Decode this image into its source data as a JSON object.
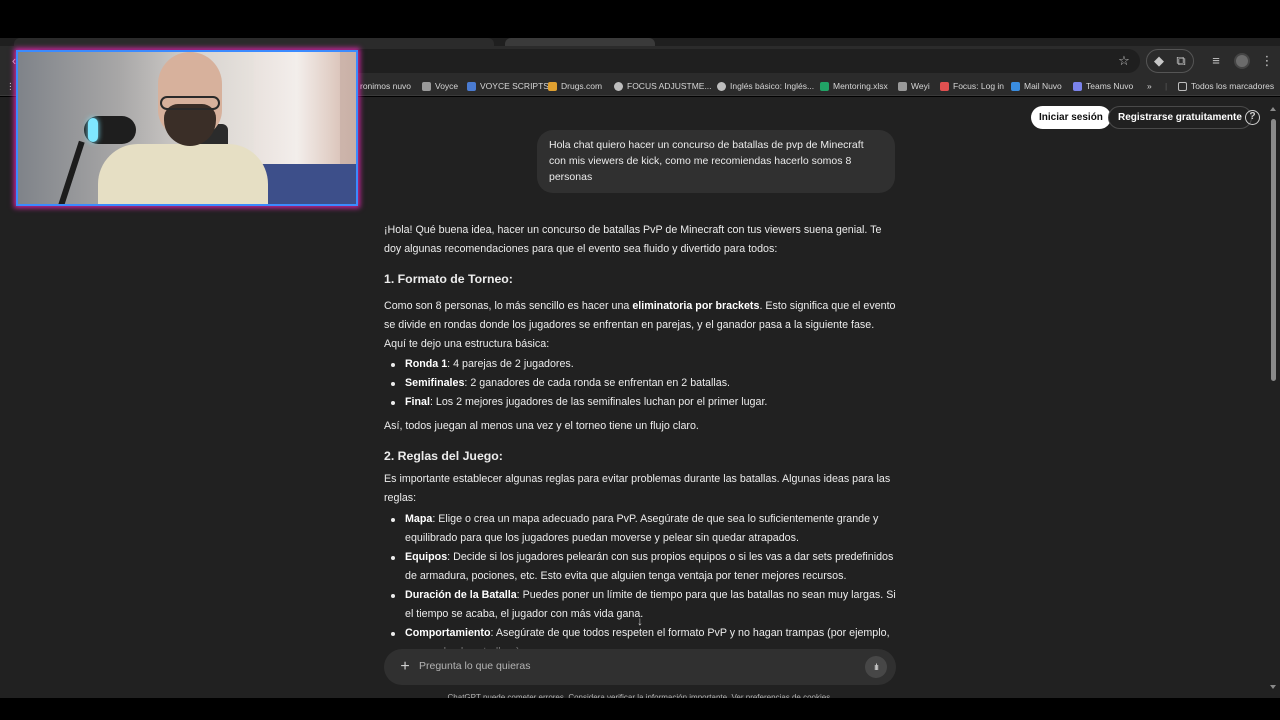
{
  "browser": {
    "bookmarks": [
      {
        "label": "ronimos nuvo",
        "color": "#cccccc"
      },
      {
        "label": "Voyce",
        "color": "#9a9a9a"
      },
      {
        "label": "VOYCE SCRIPTS",
        "color": "#4a7bd1"
      },
      {
        "label": "Drugs.com",
        "color": "#e0a030"
      },
      {
        "label": "FOCUS ADJUSTME...",
        "color": "#bdbdbd"
      },
      {
        "label": "Inglés básico: Inglés...",
        "color": "#bdbdbd"
      },
      {
        "label": "Mentoring.xlsx",
        "color": "#21a366"
      },
      {
        "label": "Weyi",
        "color": "#9a9a9a"
      },
      {
        "label": "Focus: Log in",
        "color": "#e05050"
      },
      {
        "label": "Mail Nuvo",
        "color": "#3a8de0"
      },
      {
        "label": "Teams Nuvo",
        "color": "#7b83eb"
      }
    ],
    "more_bookmarks_icon": "chevron-double-right-icon",
    "all_bookmarks_label": "Todos los marcadores"
  },
  "header": {
    "login_label": "Iniciar sesión",
    "signup_label": "Registrarse gratuitamente",
    "help_icon": "?"
  },
  "conversation": {
    "user_message": "Hola chat quiero hacer un concurso de batallas de pvp de Minecraft con mis viewers de kick, como me recomiendas hacerlo somos 8 personas",
    "assistant": {
      "intro": "¡Hola! Qué buena idea, hacer un concurso de batallas PvP de Minecraft con tus viewers suena genial. Te doy algunas recomendaciones para que el evento sea fluido y divertido para todos:",
      "section1_title": "1. Formato de Torneo:",
      "section1_p_pre": "Como son 8 personas, lo más sencillo es hacer una ",
      "section1_p_bold": "eliminatoria por brackets",
      "section1_p_post": ". Esto significa que el evento se divide en rondas donde los jugadores se enfrentan en parejas, y el ganador pasa a la siguiente fase. Aquí te dejo una estructura básica:",
      "section1_items": [
        {
          "term": "Ronda 1",
          "text": ": 4 parejas de 2 jugadores."
        },
        {
          "term": "Semifinales",
          "text": ": 2 ganadores de cada ronda se enfrentan en 2 batallas."
        },
        {
          "term": "Final",
          "text": ": Los 2 mejores jugadores de las semifinales luchan por el primer lugar."
        }
      ],
      "section1_outro": "Así, todos juegan al menos una vez y el torneo tiene un flujo claro.",
      "section2_title": "2. Reglas del Juego:",
      "section2_p": "Es importante establecer algunas reglas para evitar problemas durante las batallas. Algunas ideas para las reglas:",
      "section2_items": [
        {
          "term": "Mapa",
          "text": ": Elige o crea un mapa adecuado para PvP. Asegúrate de que sea lo suficientemente grande y equilibrado para que los jugadores puedan moverse y pelear sin quedar atrapados."
        },
        {
          "term": "Equipos",
          "text": ": Decide si los jugadores pelearán con sus propios equipos o si les vas a dar sets predefinidos de armadura, pociones, etc. Esto evita que alguien tenga ventaja por tener mejores recursos."
        },
        {
          "term": "Duración de la Batalla",
          "text": ": Puedes poner un límite de tiempo para que las batallas no sean muy largas. Si el tiempo se acaba, el jugador con más vida gana."
        },
        {
          "term": "Comportamiento",
          "text": ": Asegúrate de que todos respeten el formato PvP y no hagan trampas (por ejemplo, no usar hacks o trollear)."
        }
      ]
    }
  },
  "composer": {
    "placeholder": "Pregunta lo que quieras"
  },
  "footer": {
    "disclaimer": "ChatGPT puede cometer errores. Considera verificar la información importante. Ver preferencias de cookies."
  }
}
